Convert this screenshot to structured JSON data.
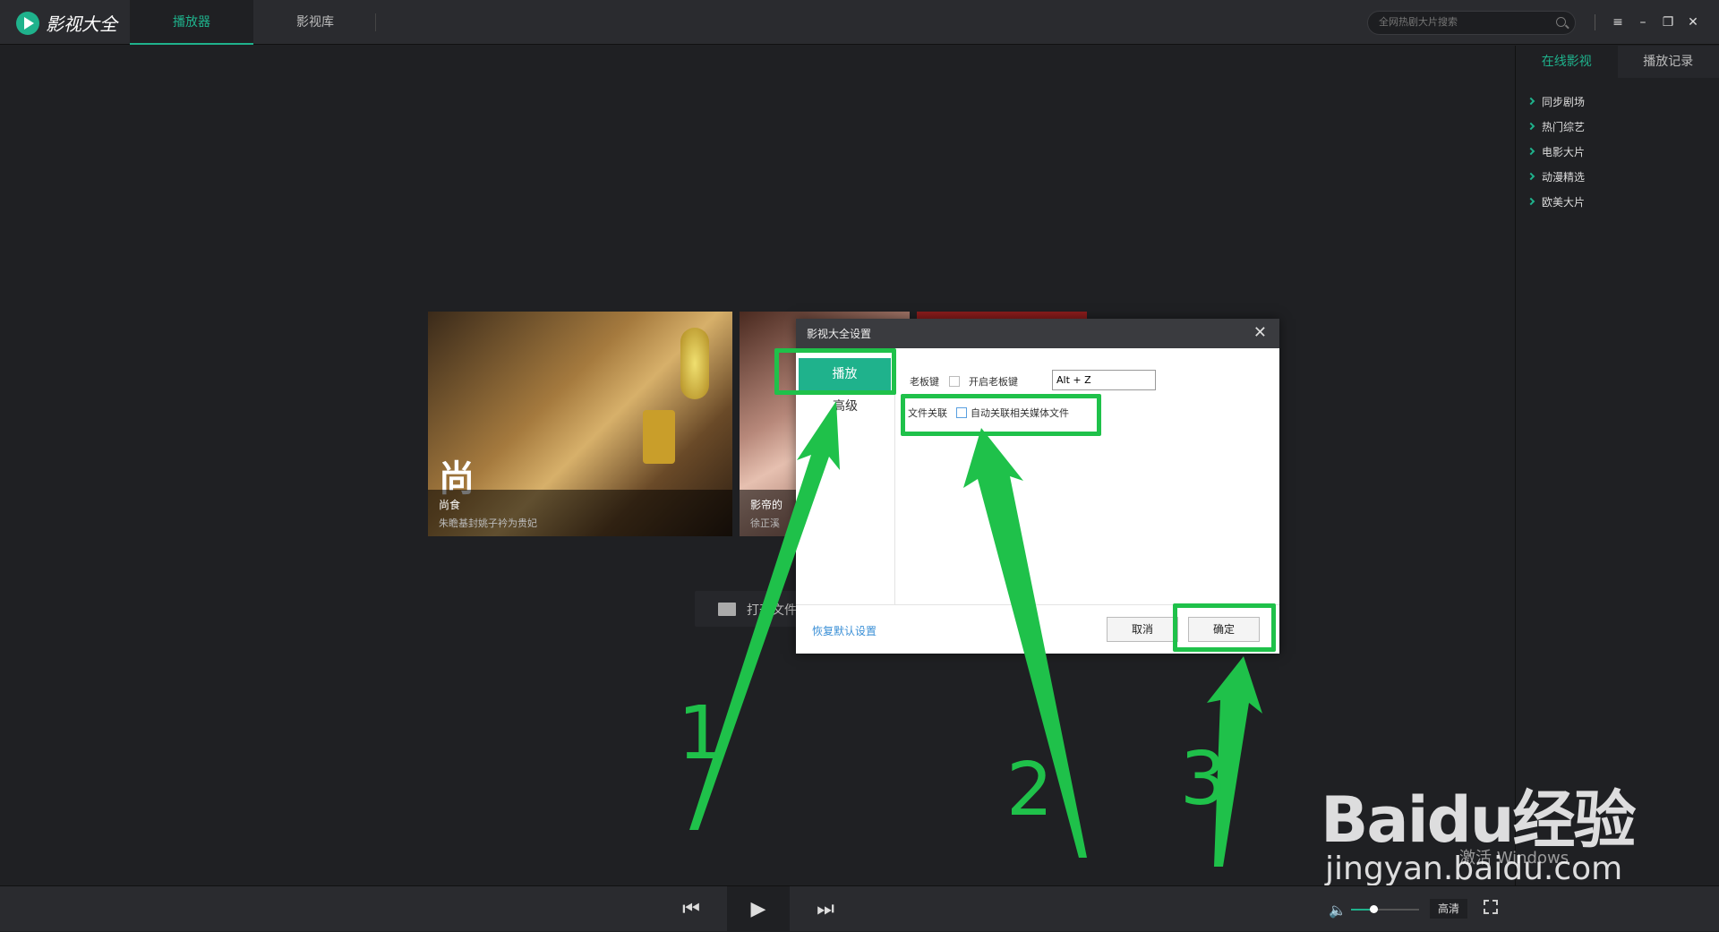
{
  "app": {
    "title": "影视大全"
  },
  "tabs": [
    {
      "label": "播放器"
    },
    {
      "label": "影视库"
    }
  ],
  "search": {
    "placeholder": "全网热剧大片搜索"
  },
  "window_controls": {
    "menu": "≡",
    "minimize": "–",
    "restore": "❐",
    "close": "✕"
  },
  "sidebar": {
    "tabs": [
      {
        "label": "在线影视"
      },
      {
        "label": "播放记录"
      }
    ],
    "items": [
      {
        "label": "同步剧场"
      },
      {
        "label": "热门综艺"
      },
      {
        "label": "电影大片"
      },
      {
        "label": "动漫精选"
      },
      {
        "label": "欧美大片"
      }
    ]
  },
  "cards": [
    {
      "overlay_char": "尚",
      "title": "尚食",
      "subtitle": "朱瞻基封姚子衿为贵妃"
    },
    {
      "title": "影帝的",
      "subtitle": "徐正溪"
    }
  ],
  "open_file": {
    "label": "打开文件"
  },
  "dialog": {
    "title": "影视大全设置",
    "close": "✕",
    "nav": [
      {
        "label": "播放"
      },
      {
        "label": "高级"
      }
    ],
    "boss_key": {
      "label": "老板键",
      "checkbox_label": "开启老板键",
      "hotkey_value": "Alt + Z"
    },
    "file_assoc": {
      "label": "文件关联",
      "checkbox_label": "自动关联相关媒体文件"
    },
    "restore_defaults": "恢复默认设置",
    "cancel": "取消",
    "confirm": "确定"
  },
  "annotations": {
    "step1": "1",
    "step2": "2",
    "step3": "3",
    "color": "#1fc14a"
  },
  "player": {
    "prev": "⏮",
    "play": "▶",
    "next": "⏭",
    "volume_level": 0.33,
    "quality": "高清"
  },
  "watermark": {
    "brand": "Baidu经验",
    "url": "jingyan.baidu.com",
    "os_notice": "激活 Windows"
  },
  "colors": {
    "accent": "#1fb28c",
    "topbar": "#2a2b2f",
    "background": "#1f2023"
  }
}
